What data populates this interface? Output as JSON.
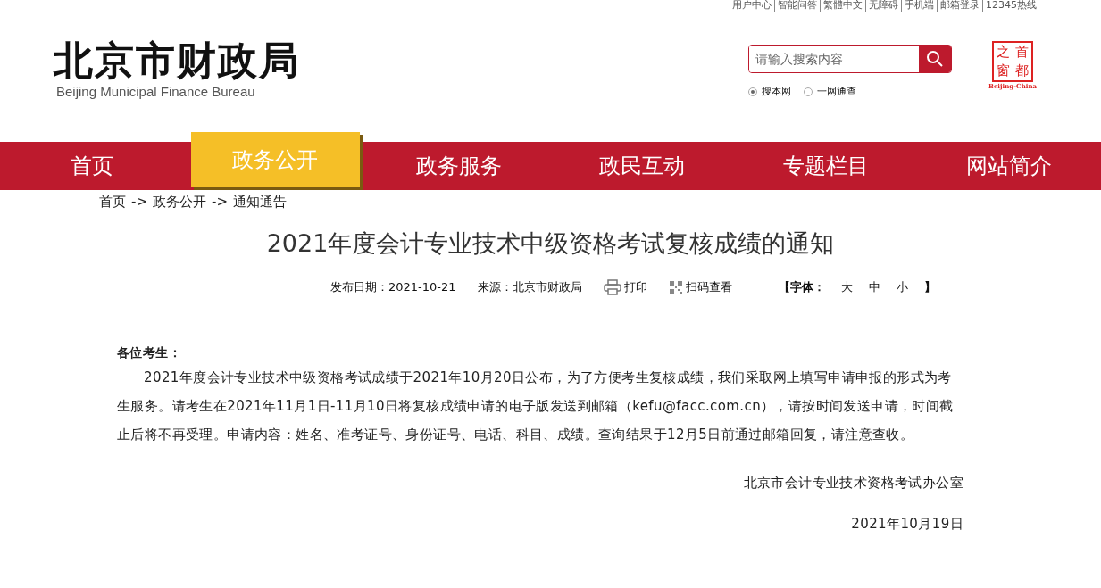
{
  "top_links": [
    "用户中心",
    "智能问答",
    "繁體中文",
    "无障碍",
    "手机端",
    "邮箱登录",
    "12345热线"
  ],
  "logo": {
    "title": "北京市财政局",
    "subtitle": "Beijing Municipal Finance Bureau"
  },
  "search": {
    "placeholder": "请输入搜索内容",
    "scopes": [
      {
        "label": "搜本网",
        "selected": true
      },
      {
        "label": "一网通查",
        "selected": false
      }
    ]
  },
  "stamp": {
    "chars": [
      "之",
      "首",
      "窗",
      "都"
    ],
    "caption": "Beijing-China"
  },
  "nav": [
    {
      "label": "首页",
      "selected": false
    },
    {
      "label": "政务公开",
      "selected": true
    },
    {
      "label": "政务服务",
      "selected": false
    },
    {
      "label": "政民互动",
      "selected": false
    },
    {
      "label": "专题栏目",
      "selected": false
    },
    {
      "label": "网站简介",
      "selected": false
    }
  ],
  "breadcrumb": {
    "items": [
      "首页",
      "政务公开",
      "通知通告"
    ],
    "separator": "->"
  },
  "article": {
    "title": "2021年度会计专业技术中级资格考试复核成绩的通知",
    "date": "发布日期：2021-10-21",
    "source": "来源：北京市财政局",
    "print": "打印",
    "qr": "扫码查看",
    "font_size": {
      "open": "【字体：",
      "options": [
        "大",
        "中",
        "小"
      ],
      "close": "】"
    },
    "salutation": "各位考生：",
    "paragraphs": [
      "2021年度会计专业技术中级资格考试成绩于2021年10月20日公布，为了方便考生复核成绩，我们采取网上填写申请申报的形式为考生服务。请考生在2021年11月1日-11月10日将复核成绩申请的电子版发送到邮箱（kefu@facc.com.cn），请按时间发送申请，时间截止后将不再受理。申请内容：姓名、准考证号、身份证号、电话、科目、成绩。查询结果于12月5日前通过邮箱回复，请注意查收。"
    ],
    "signature": "北京市会计专业技术资格考试办公室",
    "sign_date": "2021年10月19日"
  }
}
